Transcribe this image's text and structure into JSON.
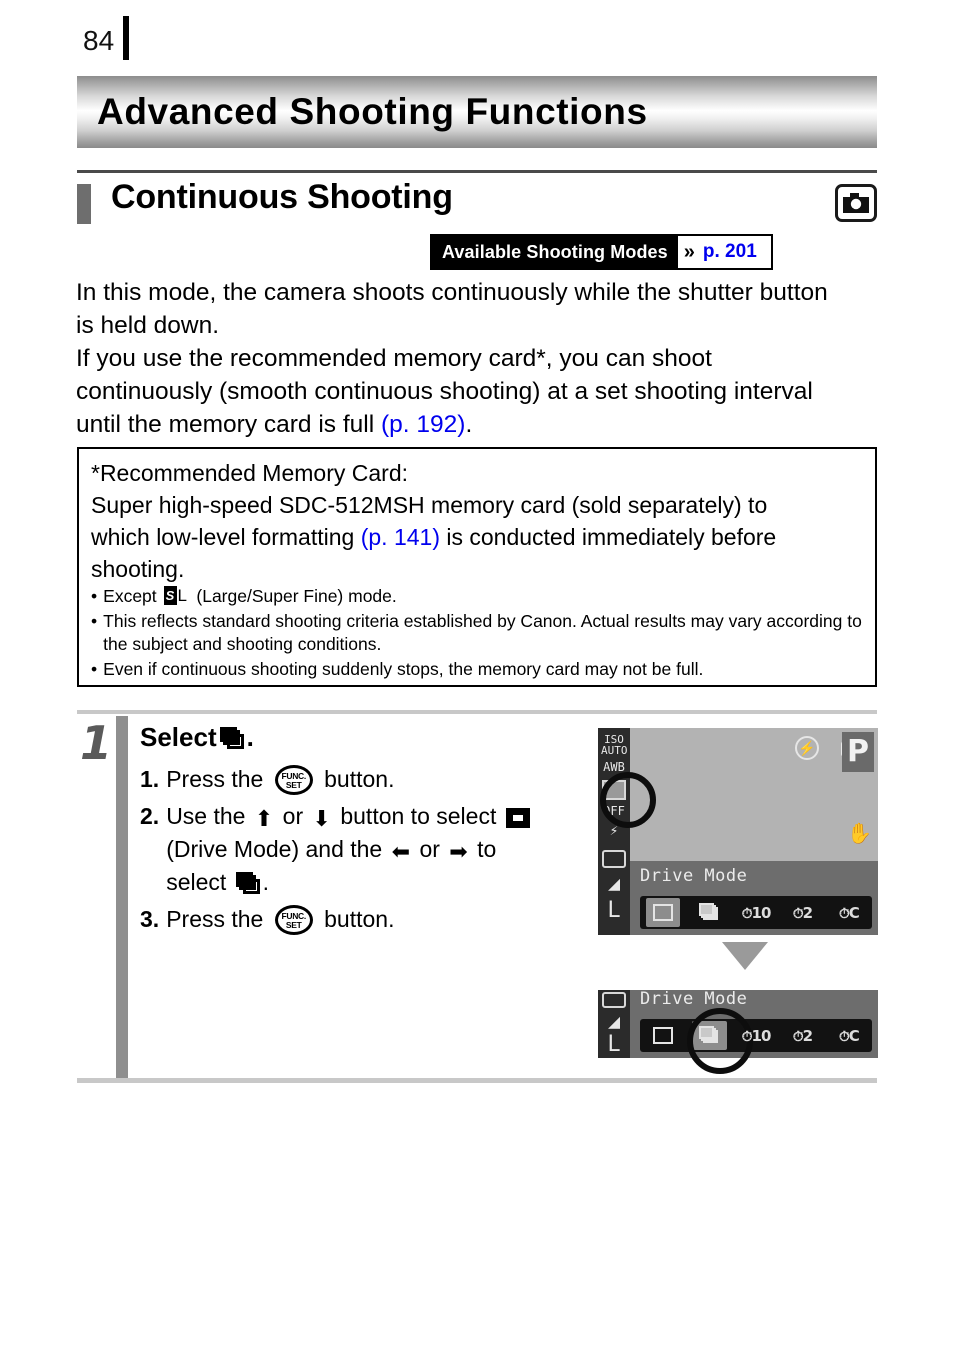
{
  "page": {
    "number": "84"
  },
  "chapter": {
    "title": "Advanced Shooting Functions"
  },
  "section": {
    "title": "Continuous Shooting",
    "camera_icon": "camera-icon"
  },
  "modes_badge": {
    "label": "Available Shooting Modes",
    "chevron": "»",
    "page_ref": "p. 201",
    "ref_color": "#0000ee"
  },
  "body": {
    "paragraph1_line1": "In this mode, the camera shoots continuously while the shutter button",
    "paragraph1_line2": "is held down.",
    "paragraph2_line1": "If you use the recommended memory card*, you can shoot",
    "paragraph2_line2": "continuously (smooth continuous shooting) at a set shooting interval",
    "paragraph2_line3_pre": "until the memory card is full ",
    "paragraph2_line3_link": "(p. 192)",
    "paragraph2_line3_post": "."
  },
  "note_box": {
    "heading": "*Recommended Memory Card:",
    "line1": "Super high-speed SDC-512MSH memory card (sold separately) to",
    "line2_pre": "which low-level formatting ",
    "line2_link": "(p. 141)",
    "line2_post": " is conducted immediately before",
    "line3": "shooting.",
    "bullets": [
      {
        "marker": "•",
        "pre": "Except ",
        "icon": "large-superfine-quality-icon",
        "post": " (Large/Super Fine) mode."
      },
      {
        "marker": "•",
        "text": "This reflects standard shooting criteria established by Canon. Actual results may vary according to the subject and shooting conditions."
      },
      {
        "marker": "•",
        "text": "Even if continuous shooting suddenly stops, the memory card may not be full."
      }
    ]
  },
  "step": {
    "number": "1",
    "title_pre": "Select ",
    "title_icon": "continuous-shooting-icon",
    "title_post": ".",
    "items": [
      {
        "num": "1.",
        "pre": "Press the ",
        "button": "FUNC SET",
        "post": " button."
      },
      {
        "num": "2.",
        "pre": "Use the ",
        "up": "⬆",
        "mid1": " or ",
        "down": "⬇",
        "mid2": " button to select ",
        "icon1": "drive-mode-icon",
        "line2_pre": "(Drive Mode) and the ",
        "left": "⬅",
        "mid3": " or ",
        "right": "➡",
        "mid4": " to",
        "line3_pre": "select ",
        "icon2": "continuous-shooting-icon",
        "line3_post": "."
      },
      {
        "num": "3.",
        "pre": "Press the ",
        "button": "FUNC SET",
        "post": " button."
      }
    ]
  },
  "lcd_screen_1": {
    "sidebar_icons": [
      "iso-auto-icon",
      "white-balance-icon",
      "drive-mode-icon",
      "focus-mode-icon",
      "flash-exposure-comp-icon",
      "metering-mode-icon",
      "contrast-icon",
      "image-quality-L-icon"
    ],
    "iso_label_top": "ISO",
    "iso_label_bottom": "AUTO",
    "quality_label": "L",
    "top_icons": [
      "flash-off-icon",
      "red-eye-icon"
    ],
    "shooting_mode": "P",
    "shake_warning_icon": "camera-shake-icon",
    "drive_panel_label": "Drive Mode",
    "drive_options": [
      {
        "name": "single-shot",
        "label": "",
        "selected": true
      },
      {
        "name": "continuous-shooting",
        "label": "",
        "selected": false
      },
      {
        "name": "self-timer-10s",
        "label": "10",
        "selected": false
      },
      {
        "name": "self-timer-2s",
        "label": "2",
        "selected": false
      },
      {
        "name": "self-timer-custom",
        "label": "C",
        "selected": false
      }
    ],
    "highlight": "drive-mode-sidebar-highlight"
  },
  "lcd_screen_2": {
    "drive_panel_label": "Drive Mode",
    "drive_options": [
      {
        "name": "single-shot",
        "label": "",
        "selected": false
      },
      {
        "name": "continuous-shooting",
        "label": "",
        "selected": true
      },
      {
        "name": "self-timer-10s",
        "label": "10",
        "selected": false
      },
      {
        "name": "self-timer-2s",
        "label": "2",
        "selected": false
      },
      {
        "name": "self-timer-custom",
        "label": "C",
        "selected": false
      }
    ],
    "quality_label": "L",
    "highlight": "continuous-shooting-option-highlight"
  },
  "flow_arrow": "down-arrow-icon"
}
